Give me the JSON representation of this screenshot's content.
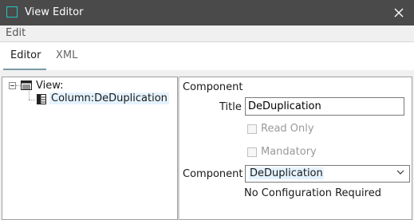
{
  "window": {
    "title": "View Editor"
  },
  "menu": {
    "edit": "Edit"
  },
  "tabs": [
    {
      "label": "Editor"
    },
    {
      "label": "XML"
    }
  ],
  "tree": {
    "root": "View:",
    "child": "Column:DeDuplication"
  },
  "properties": {
    "heading": "Component",
    "title_label": "Title",
    "title_value": "DeDuplication",
    "read_only_label": "Read Only",
    "mandatory_label": "Mandatory",
    "component_label": "Component",
    "component_value": "DeDuplication",
    "config_note": "No Configuration Required"
  },
  "colors": {
    "titlebar": "#4a4a4a",
    "accent": "#27c4c4",
    "selection": "#e5f3ff"
  },
  "icons": [
    "app-icon",
    "close-icon",
    "tree-collapse-icon",
    "view-icon",
    "column-icon",
    "chevron-down-icon"
  ]
}
